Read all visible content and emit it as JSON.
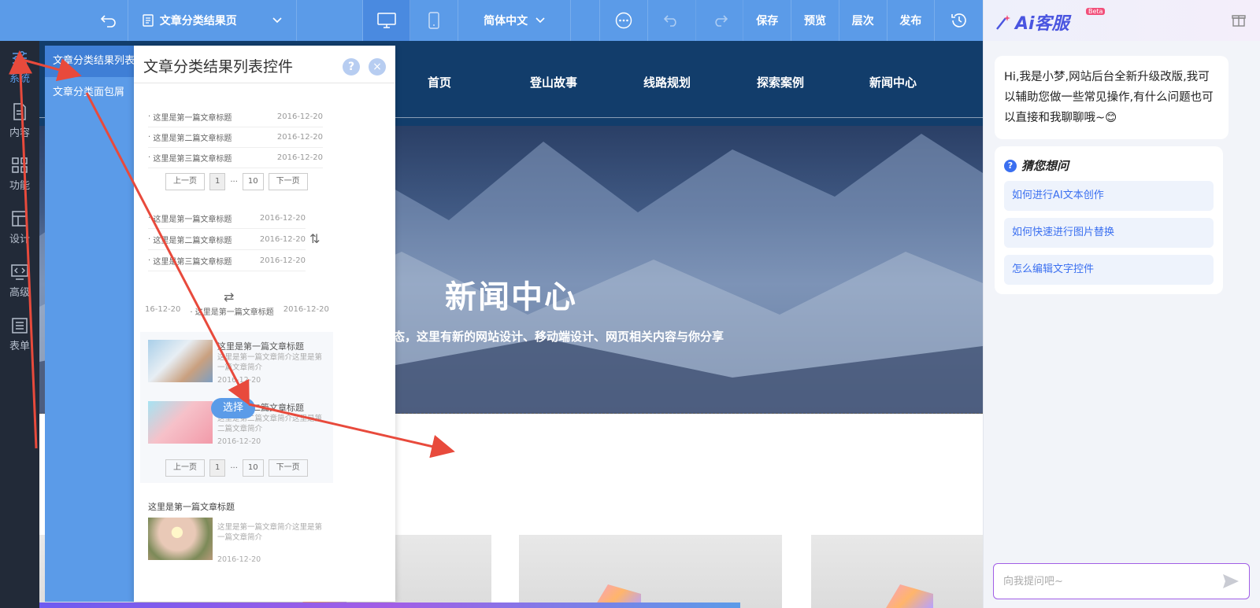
{
  "toolbar": {
    "page_name": "文章分类结果页",
    "language": "简体中文",
    "save": "保存",
    "preview": "预览",
    "layers": "层次",
    "publish": "发布"
  },
  "sidebar": {
    "items": [
      {
        "label": "系统",
        "icon": "sliders-icon",
        "active": true
      },
      {
        "label": "内容",
        "icon": "document-icon"
      },
      {
        "label": "功能",
        "icon": "grid-icon"
      },
      {
        "label": "设计",
        "icon": "layout-icon"
      },
      {
        "label": "高级",
        "icon": "code-monitor-icon"
      },
      {
        "label": "表单",
        "icon": "form-icon"
      }
    ]
  },
  "submenu": {
    "items": [
      {
        "label": "文章分类结果列表",
        "active": true
      },
      {
        "label": "文章分类面包屑"
      }
    ]
  },
  "panel": {
    "title": "文章分类结果列表控件",
    "help": "?",
    "close": "×",
    "select": "选择",
    "list_a": [
      {
        "title": "这里是第一篇文章标题",
        "date": "2016-12-20"
      },
      {
        "title": "这里是第二篇文章标题",
        "date": "2016-12-20"
      },
      {
        "title": "这里是第三篇文章标题",
        "date": "2016-12-20"
      }
    ],
    "pager": {
      "prev": "上一页",
      "current": "1",
      "ellipsis": "···",
      "last": "10",
      "next": "下一页"
    },
    "list_b": [
      {
        "title": "这里是第一篇文章标题",
        "date": "2016-12-20"
      },
      {
        "title": "这里是第二篇文章标题",
        "date": "2016-12-20"
      },
      {
        "title": "这里是第三篇文章标题",
        "date": "2016-12-20"
      }
    ],
    "marquee": {
      "date_left": "16-12-20",
      "title": "这里是第一篇文章标题",
      "date_right": "2016-12-20"
    },
    "img_list": [
      {
        "title": "这里是第一篇文章标题",
        "desc": "这里是第一篇文章简介这里是第一篇文章简介",
        "date": "2016-12-20"
      },
      {
        "title": "这里是第二篇文章标题",
        "desc": "这里是第二篇文章简介这里是第二篇文章简介",
        "date": "2016-12-20"
      }
    ],
    "bottom_item": {
      "title": "这里是第一篇文章标题",
      "desc": "这里是第一篇文章简介这里是第一篇文章简介",
      "date": "2016-12-20"
    }
  },
  "site": {
    "nav": [
      "首页",
      "登山故事",
      "线路规划",
      "探索案例",
      "新闻中心"
    ],
    "hero_title": "新闻中心",
    "hero_subtitle": "这里有新的公司动态，这里有新的网站设计、移动端设计、网页相关内容与你分享"
  },
  "ai": {
    "brand": "Ai客服",
    "beta": "Beta",
    "greeting": "Hi,我是小梦,网站后台全新升级改版,我可以辅助您做一些常见操作,有什么问题也可以直接和我聊聊哦~😊",
    "guess_title": "猜您想问",
    "questions": [
      "如何进行AI文本创作",
      "如何快速进行图片替换",
      "怎么编辑文字控件"
    ],
    "input_placeholder": "向我提问吧~"
  },
  "colors": {
    "accent": "#5b9be8",
    "sidebar": "#222a38",
    "nav": "#123d6b",
    "annotation": "#e84a3c"
  }
}
